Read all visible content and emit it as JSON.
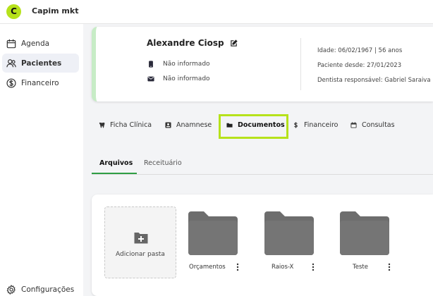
{
  "app": {
    "logo_letter": "C",
    "name": "Capim mkt"
  },
  "sidebar": {
    "items": [
      {
        "label": "Agenda",
        "icon": "calendar-icon"
      },
      {
        "label": "Pacientes",
        "icon": "users-icon"
      },
      {
        "label": "Financeiro",
        "icon": "dollar-icon"
      }
    ],
    "settings_label": "Configurações"
  },
  "patient": {
    "name": "Alexandre Ciosp",
    "phone": "Não informado",
    "email": "Não informado",
    "age": "Idade: 06/02/1967 | 56 anos",
    "since": "Paciente desde: 27/01/2023",
    "dentist": "Dentista responsável: Gabriel Saraiva"
  },
  "tabs": [
    {
      "label": "Ficha Clínica",
      "icon": "tooth-icon"
    },
    {
      "label": "Anamnese",
      "icon": "id-card-icon"
    },
    {
      "label": "Documentos",
      "icon": "folder-icon"
    },
    {
      "label": "Financeiro",
      "icon": "dollar-icon"
    },
    {
      "label": "Consultas",
      "icon": "calendar-icon"
    }
  ],
  "active_tab": "Documentos",
  "subtabs": [
    {
      "label": "Arquivos"
    },
    {
      "label": "Receituário"
    }
  ],
  "files": {
    "add_label": "Adicionar pasta",
    "folders": [
      {
        "name": "Orçamentos"
      },
      {
        "name": "Raios-X"
      },
      {
        "name": "Teste"
      }
    ]
  },
  "colors": {
    "brand": "#b6e21b",
    "accent_green": "#2f9e44",
    "card_border": "#c7ecc6",
    "folder": "#6d6d6d"
  }
}
